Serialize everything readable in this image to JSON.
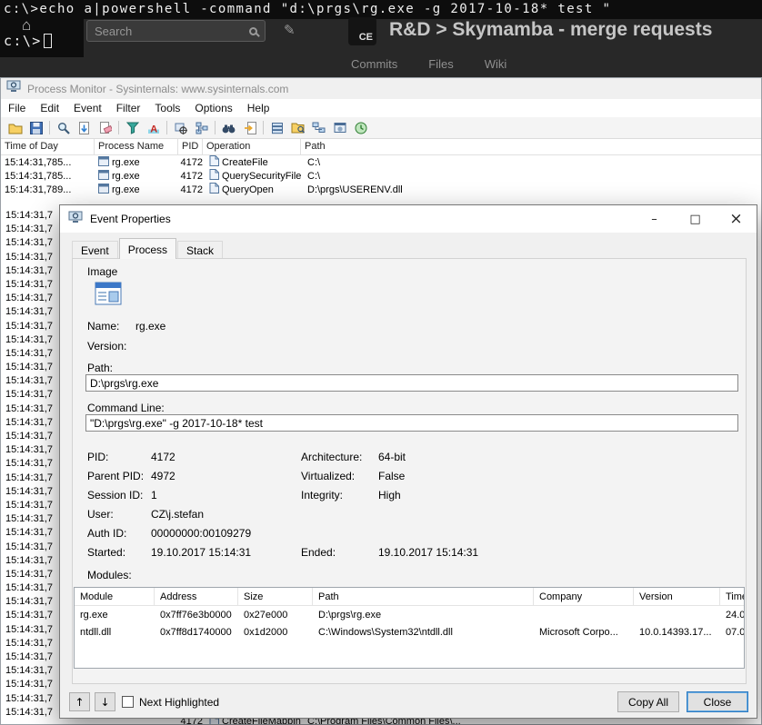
{
  "terminal": {
    "command": "c:\\>echo a|powershell -command \"d:\\prgs\\rg.exe -g 2017-10-18* test \"",
    "prompt": "c:\\>"
  },
  "browser": {
    "search_placeholder": "Search",
    "badge": "CE",
    "title": "R&D > Skymamba - merge requests",
    "tabs": [
      "Commits",
      "Files",
      "Wiki"
    ]
  },
  "procmon": {
    "title": "Process Monitor - Sysinternals: www.sysinternals.com",
    "menus": [
      "File",
      "Edit",
      "Event",
      "Filter",
      "Tools",
      "Options",
      "Help"
    ],
    "toolbar_icons": [
      "open-file-icon",
      "save-icon",
      "capture-icon",
      "autoscroll-icon",
      "clear-icon",
      "filter-icon",
      "highlight-icon",
      "include-process-icon",
      "process-tree-icon",
      "find-icon",
      "jump-to-icon",
      "registry-class-icon",
      "filesystem-class-icon",
      "network-class-icon",
      "process-class-icon",
      "profiling-class-icon"
    ],
    "columns": [
      "Time of Day",
      "Process Name",
      "PID",
      "Operation",
      "Path"
    ],
    "rows": [
      {
        "time": "15:14:31,785...",
        "process": "rg.exe",
        "pid": "4172",
        "operation": "CreateFile",
        "path": "C:\\"
      },
      {
        "time": "15:14:31,785...",
        "process": "rg.exe",
        "pid": "4172",
        "operation": "QuerySecurityFile",
        "path": "C:\\"
      },
      {
        "time": "15:14:31,789...",
        "process": "rg.exe",
        "pid": "4172",
        "operation": "QueryOpen",
        "path": "D:\\prgs\\USERENV.dll"
      }
    ],
    "clipped_time": "15:14:31,7",
    "clipped_time_count": 37,
    "bottom_row": {
      "pid": "4172",
      "operation": "CreateFileMapping",
      "path": "C:\\Program Files\\Common Files\\..."
    }
  },
  "dialog": {
    "title": "Event Properties",
    "tabs": [
      "Event",
      "Process",
      "Stack"
    ],
    "active_tab": "Process",
    "image_group_label": "Image",
    "name_label": "Name:",
    "name_value": "rg.exe",
    "version_label": "Version:",
    "version_value": "",
    "path_label": "Path:",
    "path_value": "D:\\prgs\\rg.exe",
    "cmdline_label": "Command Line:",
    "cmdline_value": "\"D:\\prgs\\rg.exe\" -g 2017-10-18* test",
    "details": [
      {
        "label": "PID:",
        "value": "4172",
        "label2": "Architecture:",
        "value2": "64-bit"
      },
      {
        "label": "Parent PID:",
        "value": "4972",
        "label2": "Virtualized:",
        "value2": "False"
      },
      {
        "label": "Session ID:",
        "value": "1",
        "label2": "Integrity:",
        "value2": "High"
      },
      {
        "label": "User:",
        "value": "CZ\\j.stefan",
        "label2": "",
        "value2": ""
      },
      {
        "label": "Auth ID:",
        "value": "00000000:00109279",
        "label2": "",
        "value2": ""
      },
      {
        "label": "Started:",
        "value": "19.10.2017 15:14:31",
        "label2": "Ended:",
        "value2": "19.10.2017 15:14:31"
      }
    ],
    "modules_label": "Modules:",
    "modules": {
      "columns": [
        "Module",
        "Address",
        "Size",
        "Path",
        "Company",
        "Version",
        "Time"
      ],
      "rows": [
        [
          "rg.exe",
          "0x7ff76e3b0000",
          "0x27e000",
          "D:\\prgs\\rg.exe",
          "",
          "",
          "24.0"
        ],
        [
          "ntdll.dll",
          "0x7ff8d1740000",
          "0x1d2000",
          "C:\\Windows\\System32\\ntdll.dll",
          "Microsoft Corpo...",
          "10.0.14393.17...",
          "07.0"
        ]
      ]
    },
    "next_highlighted_label": "Next Highlighted",
    "copy_all_label": "Copy All",
    "close_label": "Close",
    "window_controls": {
      "minimize": "–",
      "maximize": "□",
      "close": "×"
    }
  }
}
